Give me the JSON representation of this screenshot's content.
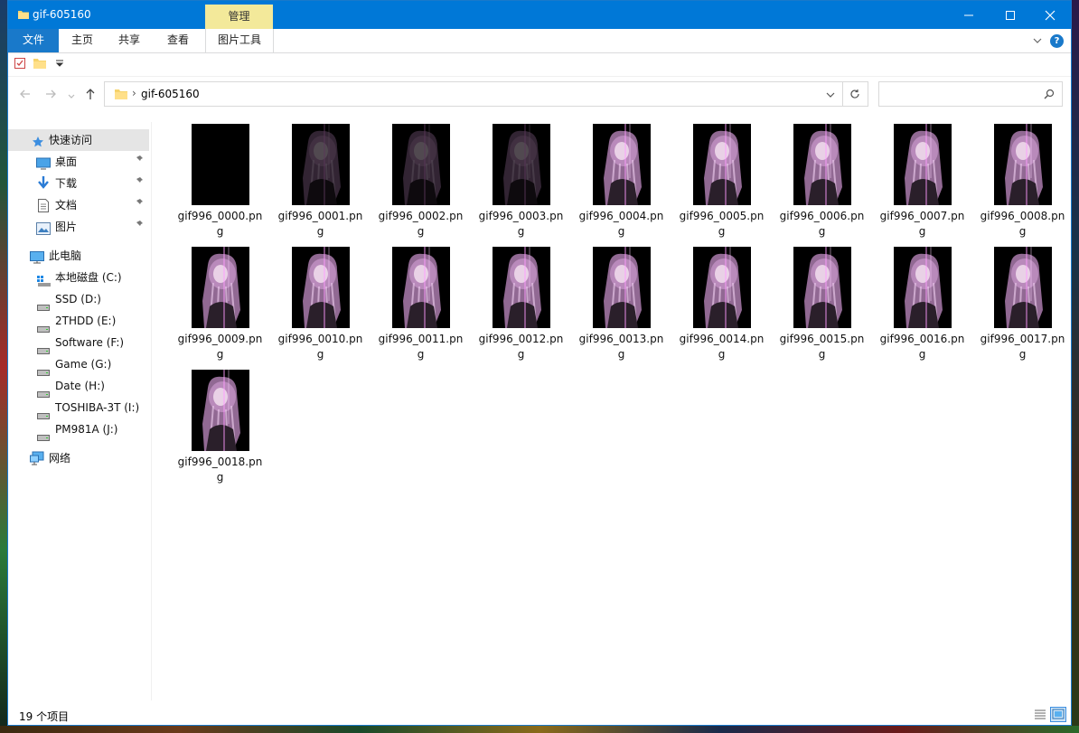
{
  "window": {
    "title": "gif-605160",
    "manage_tab": "管理"
  },
  "ribbon": {
    "tabs": [
      "文件",
      "主页",
      "共享",
      "查看",
      "图片工具"
    ],
    "help": "?"
  },
  "address": {
    "path": "gif-605160",
    "separator": "›"
  },
  "nav": {
    "quick_access": {
      "label": "快速访问",
      "items": [
        "桌面",
        "下载",
        "文档",
        "图片"
      ]
    },
    "this_pc": {
      "label": "此电脑",
      "drives": [
        "本地磁盘 (C:)",
        "SSD (D:)",
        "2THDD (E:)",
        "Software (F:)",
        "Game (G:)",
        "Date (H:)",
        "TOSHIBA-3T (I:)",
        "PM981A (J:)"
      ]
    },
    "network": {
      "label": "网络"
    }
  },
  "files": [
    {
      "line1": "gif996_0000.pn",
      "line2": "g"
    },
    {
      "line1": "gif996_0001.pn",
      "line2": "g"
    },
    {
      "line1": "gif996_0002.pn",
      "line2": "g"
    },
    {
      "line1": "gif996_0003.pn",
      "line2": "g"
    },
    {
      "line1": "gif996_0004.pn",
      "line2": "g"
    },
    {
      "line1": "gif996_0005.pn",
      "line2": "g"
    },
    {
      "line1": "gif996_0006.pn",
      "line2": "g"
    },
    {
      "line1": "gif996_0007.pn",
      "line2": "g"
    },
    {
      "line1": "gif996_0008.pn",
      "line2": "g"
    },
    {
      "line1": "gif996_0009.pn",
      "line2": "g"
    },
    {
      "line1": "gif996_0010.pn",
      "line2": "g"
    },
    {
      "line1": "gif996_0011.pn",
      "line2": "g"
    },
    {
      "line1": "gif996_0012.pn",
      "line2": "g"
    },
    {
      "line1": "gif996_0013.pn",
      "line2": "g"
    },
    {
      "line1": "gif996_0014.pn",
      "line2": "g"
    },
    {
      "line1": "gif996_0015.pn",
      "line2": "g"
    },
    {
      "line1": "gif996_0016.pn",
      "line2": "g"
    },
    {
      "line1": "gif996_0017.pn",
      "line2": "g"
    },
    {
      "line1": "gif996_0018.pn",
      "line2": "g"
    }
  ],
  "status": {
    "count": "19 个项目"
  },
  "colors": {
    "titlebar": "#0078d7",
    "manage_tab": "#f3e99a",
    "selected_nav": "#e5e5e5"
  }
}
